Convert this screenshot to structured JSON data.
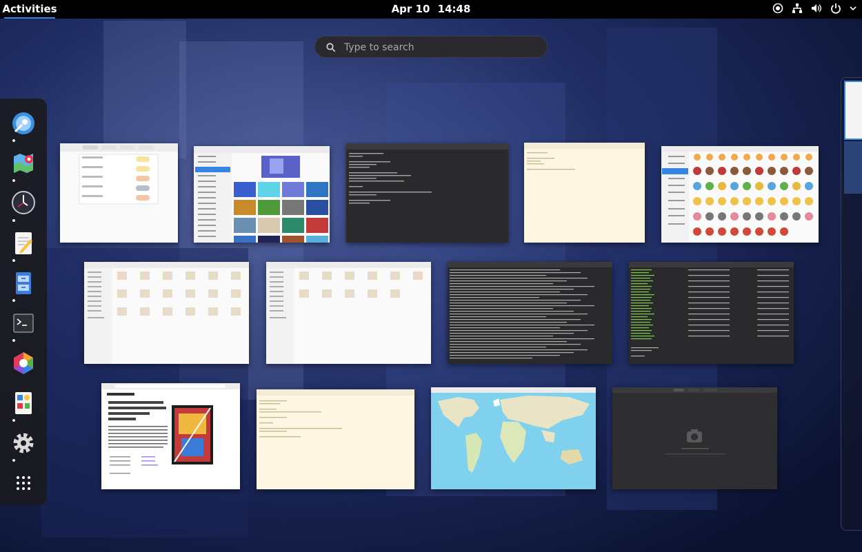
{
  "topbar": {
    "activities_label": "Activities",
    "date": "Apr 10",
    "time": "14:48",
    "tray_icons": [
      "accessibility-icon",
      "network-wired-icon",
      "volume-icon",
      "power-icon"
    ]
  },
  "search": {
    "placeholder": "Type to search"
  },
  "dash": {
    "apps": [
      {
        "name": "web-browser",
        "icon": "web-browser-icon",
        "running": true
      },
      {
        "name": "maps",
        "icon": "maps-icon",
        "running": true
      },
      {
        "name": "clocks",
        "icon": "clocks-icon",
        "running": true
      },
      {
        "name": "text-editor",
        "icon": "text-editor-icon",
        "running": true
      },
      {
        "name": "files",
        "icon": "files-icon",
        "running": true
      },
      {
        "name": "terminal",
        "icon": "terminal-icon",
        "running": true
      },
      {
        "name": "software",
        "icon": "software-icon",
        "running": false
      },
      {
        "name": "characters",
        "icon": "characters-icon",
        "running": true
      },
      {
        "name": "settings",
        "icon": "settings-icon",
        "running": true
      },
      {
        "name": "show-apps",
        "icon": "app-grid-icon",
        "running": false
      }
    ]
  },
  "windows": [
    {
      "name": "window-clocks",
      "kind": "clocks",
      "app": "Clocks"
    },
    {
      "name": "window-settings-background",
      "kind": "settings",
      "app": "Settings"
    },
    {
      "name": "window-terminal-1",
      "kind": "terminal-small",
      "app": "Terminal"
    },
    {
      "name": "window-text-editor-1",
      "kind": "editor",
      "app": "Text Editor"
    },
    {
      "name": "window-characters",
      "kind": "characters",
      "app": "Characters"
    },
    {
      "name": "window-files-home",
      "kind": "files",
      "app": "Files"
    },
    {
      "name": "window-files-folder",
      "kind": "files2",
      "app": "Files"
    },
    {
      "name": "window-terminal-2",
      "kind": "terminal-log",
      "app": "Terminal"
    },
    {
      "name": "window-terminal-3",
      "kind": "terminal-pkgs",
      "app": "Terminal"
    },
    {
      "name": "window-web-browser",
      "kind": "browser",
      "app": "Web"
    },
    {
      "name": "window-text-editor-2",
      "kind": "editor2",
      "app": "Text Editor"
    },
    {
      "name": "window-maps",
      "kind": "maps",
      "app": "Maps"
    },
    {
      "name": "window-camera",
      "kind": "camera",
      "app": "Camera"
    }
  ],
  "colors": {
    "accent": "#3584e4",
    "topbar": "#000000",
    "dash": "#1a1a1e"
  }
}
